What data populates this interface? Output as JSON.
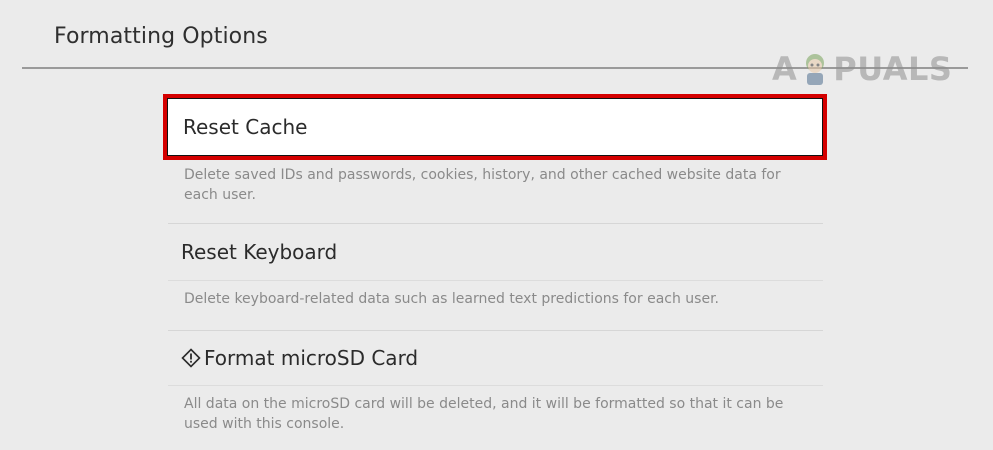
{
  "header": {
    "title": "Formatting Options"
  },
  "watermark": {
    "text_before": "A",
    "text_after": "PUALS",
    "mascot_icon": "appuals-mascot-icon"
  },
  "menu": {
    "items": [
      {
        "label": "Reset Cache",
        "description": "Delete saved IDs and passwords, cookies, history, and other cached website data for each user.",
        "selected": true
      },
      {
        "label": "Reset Keyboard",
        "description": "Delete keyboard-related data such as learned text predictions for each user.",
        "selected": false
      },
      {
        "label": "Format microSD Card",
        "description": "All data on the microSD card will be deleted, and it will be formatted so that it can be used with this console.",
        "icon": "warning-diamond-icon",
        "selected": false
      }
    ]
  },
  "colors": {
    "background": "#ebebeb",
    "highlight_border": "#d40000",
    "selected_background": "#ffffff"
  }
}
